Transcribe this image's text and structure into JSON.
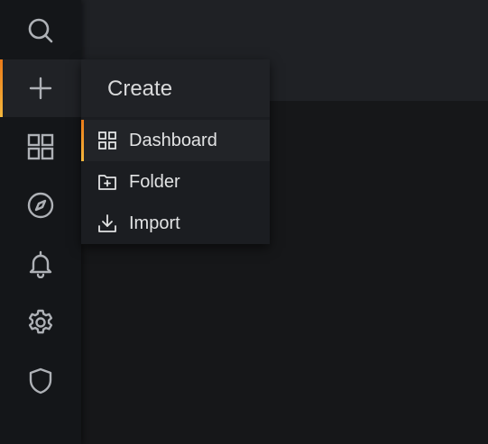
{
  "sidebar": {
    "items": [
      {
        "icon": "search-icon",
        "active": false
      },
      {
        "icon": "plus-icon",
        "active": true
      },
      {
        "icon": "dashboards-grid-icon",
        "active": false
      },
      {
        "icon": "compass-icon",
        "active": false
      },
      {
        "icon": "bell-icon",
        "active": false
      },
      {
        "icon": "gear-icon",
        "active": false
      },
      {
        "icon": "shield-icon",
        "active": false
      }
    ]
  },
  "create_menu": {
    "title": "Create",
    "items": [
      {
        "label": "Dashboard",
        "icon": "apps-grid-icon",
        "active": true
      },
      {
        "label": "Folder",
        "icon": "folder-plus-icon",
        "active": false
      },
      {
        "label": "Import",
        "icon": "import-icon",
        "active": false
      }
    ]
  },
  "colors": {
    "accent_start": "#eb7b18",
    "accent_end": "#f5b73d",
    "icon": "#aeb1b6",
    "text": "#e2e3e4"
  }
}
